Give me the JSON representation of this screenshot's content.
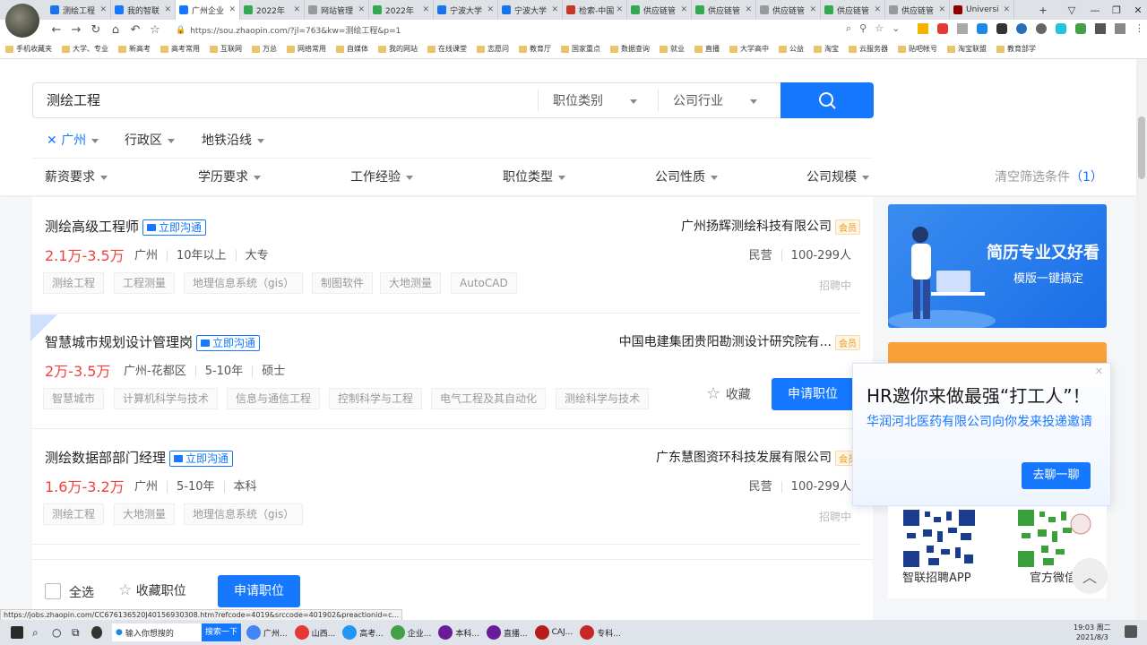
{
  "browser": {
    "tabs": [
      {
        "label": "测绘工程",
        "color": "#1a73e8"
      },
      {
        "label": "我的智联",
        "color": "#1677ff"
      },
      {
        "label": "广州企业",
        "color": "#1677ff",
        "active": true
      },
      {
        "label": "2022年",
        "color": "#34a853"
      },
      {
        "label": "网站管理",
        "color": "#999"
      },
      {
        "label": "2022年",
        "color": "#34a853"
      },
      {
        "label": "宁波大学",
        "color": "#1a73e8"
      },
      {
        "label": "宁波大学",
        "color": "#1a73e8"
      },
      {
        "label": "检索-中国",
        "color": "#c0392b"
      },
      {
        "label": "供应链管",
        "color": "#34a853"
      },
      {
        "label": "供应链管",
        "color": "#34a853"
      },
      {
        "label": "供应链管",
        "color": "#999"
      },
      {
        "label": "供应链管",
        "color": "#34a853"
      },
      {
        "label": "供应链管",
        "color": "#999"
      },
      {
        "label": "Universi",
        "color": "#8b0000"
      }
    ],
    "url": "https://sou.zhaopin.com/?jl=763&kw=测绘工程&p=1",
    "bookmarks": [
      "手机收藏夹",
      "大学、专业",
      "新高考",
      "高考常用",
      "互联网",
      "万总",
      "网络常用",
      "自媒体",
      "我的网站",
      "在线课堂",
      "志愿问",
      "教育厅",
      "国家重点",
      "数据查询",
      "就业",
      "直播",
      "大学高中",
      "公益",
      "淘宝",
      "云服务器",
      "贴吧帐号",
      "淘宝联盟",
      "教育部学"
    ],
    "status_url": "https://jobs.zhaopin.com/CC676136520J40156930308.htm?refcode=4019&srccode=401902&preactionid=c..."
  },
  "search": {
    "keyword": "测绘工程",
    "job_category": "职位类别",
    "industry": "公司行业",
    "city": "广州",
    "district": "行政区",
    "metro": "地铁沿线",
    "filters": [
      "薪资要求",
      "学历要求",
      "工作经验",
      "职位类型",
      "公司性质",
      "公司规模"
    ],
    "clear": "清空筛选条件",
    "clear_count": "（1）"
  },
  "jobs": [
    {
      "title": "测绘高级工程师",
      "chat": "立即沟通",
      "salary": "2.1万-3.5万",
      "location": "广州",
      "experience": "10年以上",
      "education": "大专",
      "tags": [
        "测绘工程",
        "工程测量",
        "地理信息系统（gis）",
        "制图软件",
        "大地测量",
        "AutoCAD"
      ],
      "company": "广州扬辉测绘科技有限公司",
      "vip": "会员",
      "company_type": "民营",
      "company_size": "100-299人",
      "hiring": "招聘中"
    },
    {
      "title": "智慧城市规划设计管理岗",
      "chat": "立即沟通",
      "salary": "2万-3.5万",
      "location": "广州-花都区",
      "experience": "5-10年",
      "education": "硕士",
      "tags": [
        "智慧城市",
        "计算机科学与技术",
        "信息与通信工程",
        "控制科学与工程",
        "电气工程及其自动化",
        "测绘科学与技术"
      ],
      "company": "中国电建集团贵阳勘测设计研究院有...",
      "vip": "会员",
      "collect": "收藏",
      "apply": "申请职位"
    },
    {
      "title": "测绘数据部部门经理",
      "chat": "立即沟通",
      "salary": "1.6万-3.2万",
      "location": "广州",
      "experience": "5-10年",
      "education": "本科",
      "tags": [
        "测绘工程",
        "大地测量",
        "地理信息系统（gis）"
      ],
      "company": "广东慧图资环科技发展有限公司",
      "vip": "会员",
      "company_type": "民营",
      "company_size": "100-299人",
      "hiring": "招聘中"
    }
  ],
  "bottom": {
    "select_all": "全选",
    "collect": "收藏职位",
    "apply": "申请职位"
  },
  "ad": {
    "line1": "简历专业又好看",
    "line2": "模版一键搞定"
  },
  "popup": {
    "title": "HR邀你来做最强“打工人”！",
    "subtitle": "华润河北医药有限公司向你发来投递邀请",
    "button": "去聊一聊"
  },
  "qr": {
    "app": "智联招聘APP",
    "wechat": "官方微信"
  },
  "taskbar": {
    "search_hint": "输入你想搜的",
    "search_btn": "搜索一下",
    "apps": [
      "广州...",
      "山西...",
      "高考...",
      "企业...",
      "本科...",
      "直播...",
      "CAJ...",
      "专科..."
    ],
    "time": "19:03 周二",
    "date": "2021/8/3"
  },
  "colors": {
    "accent": "#1677ff",
    "salary": "#f2413d",
    "vip": "#e89c1a"
  }
}
